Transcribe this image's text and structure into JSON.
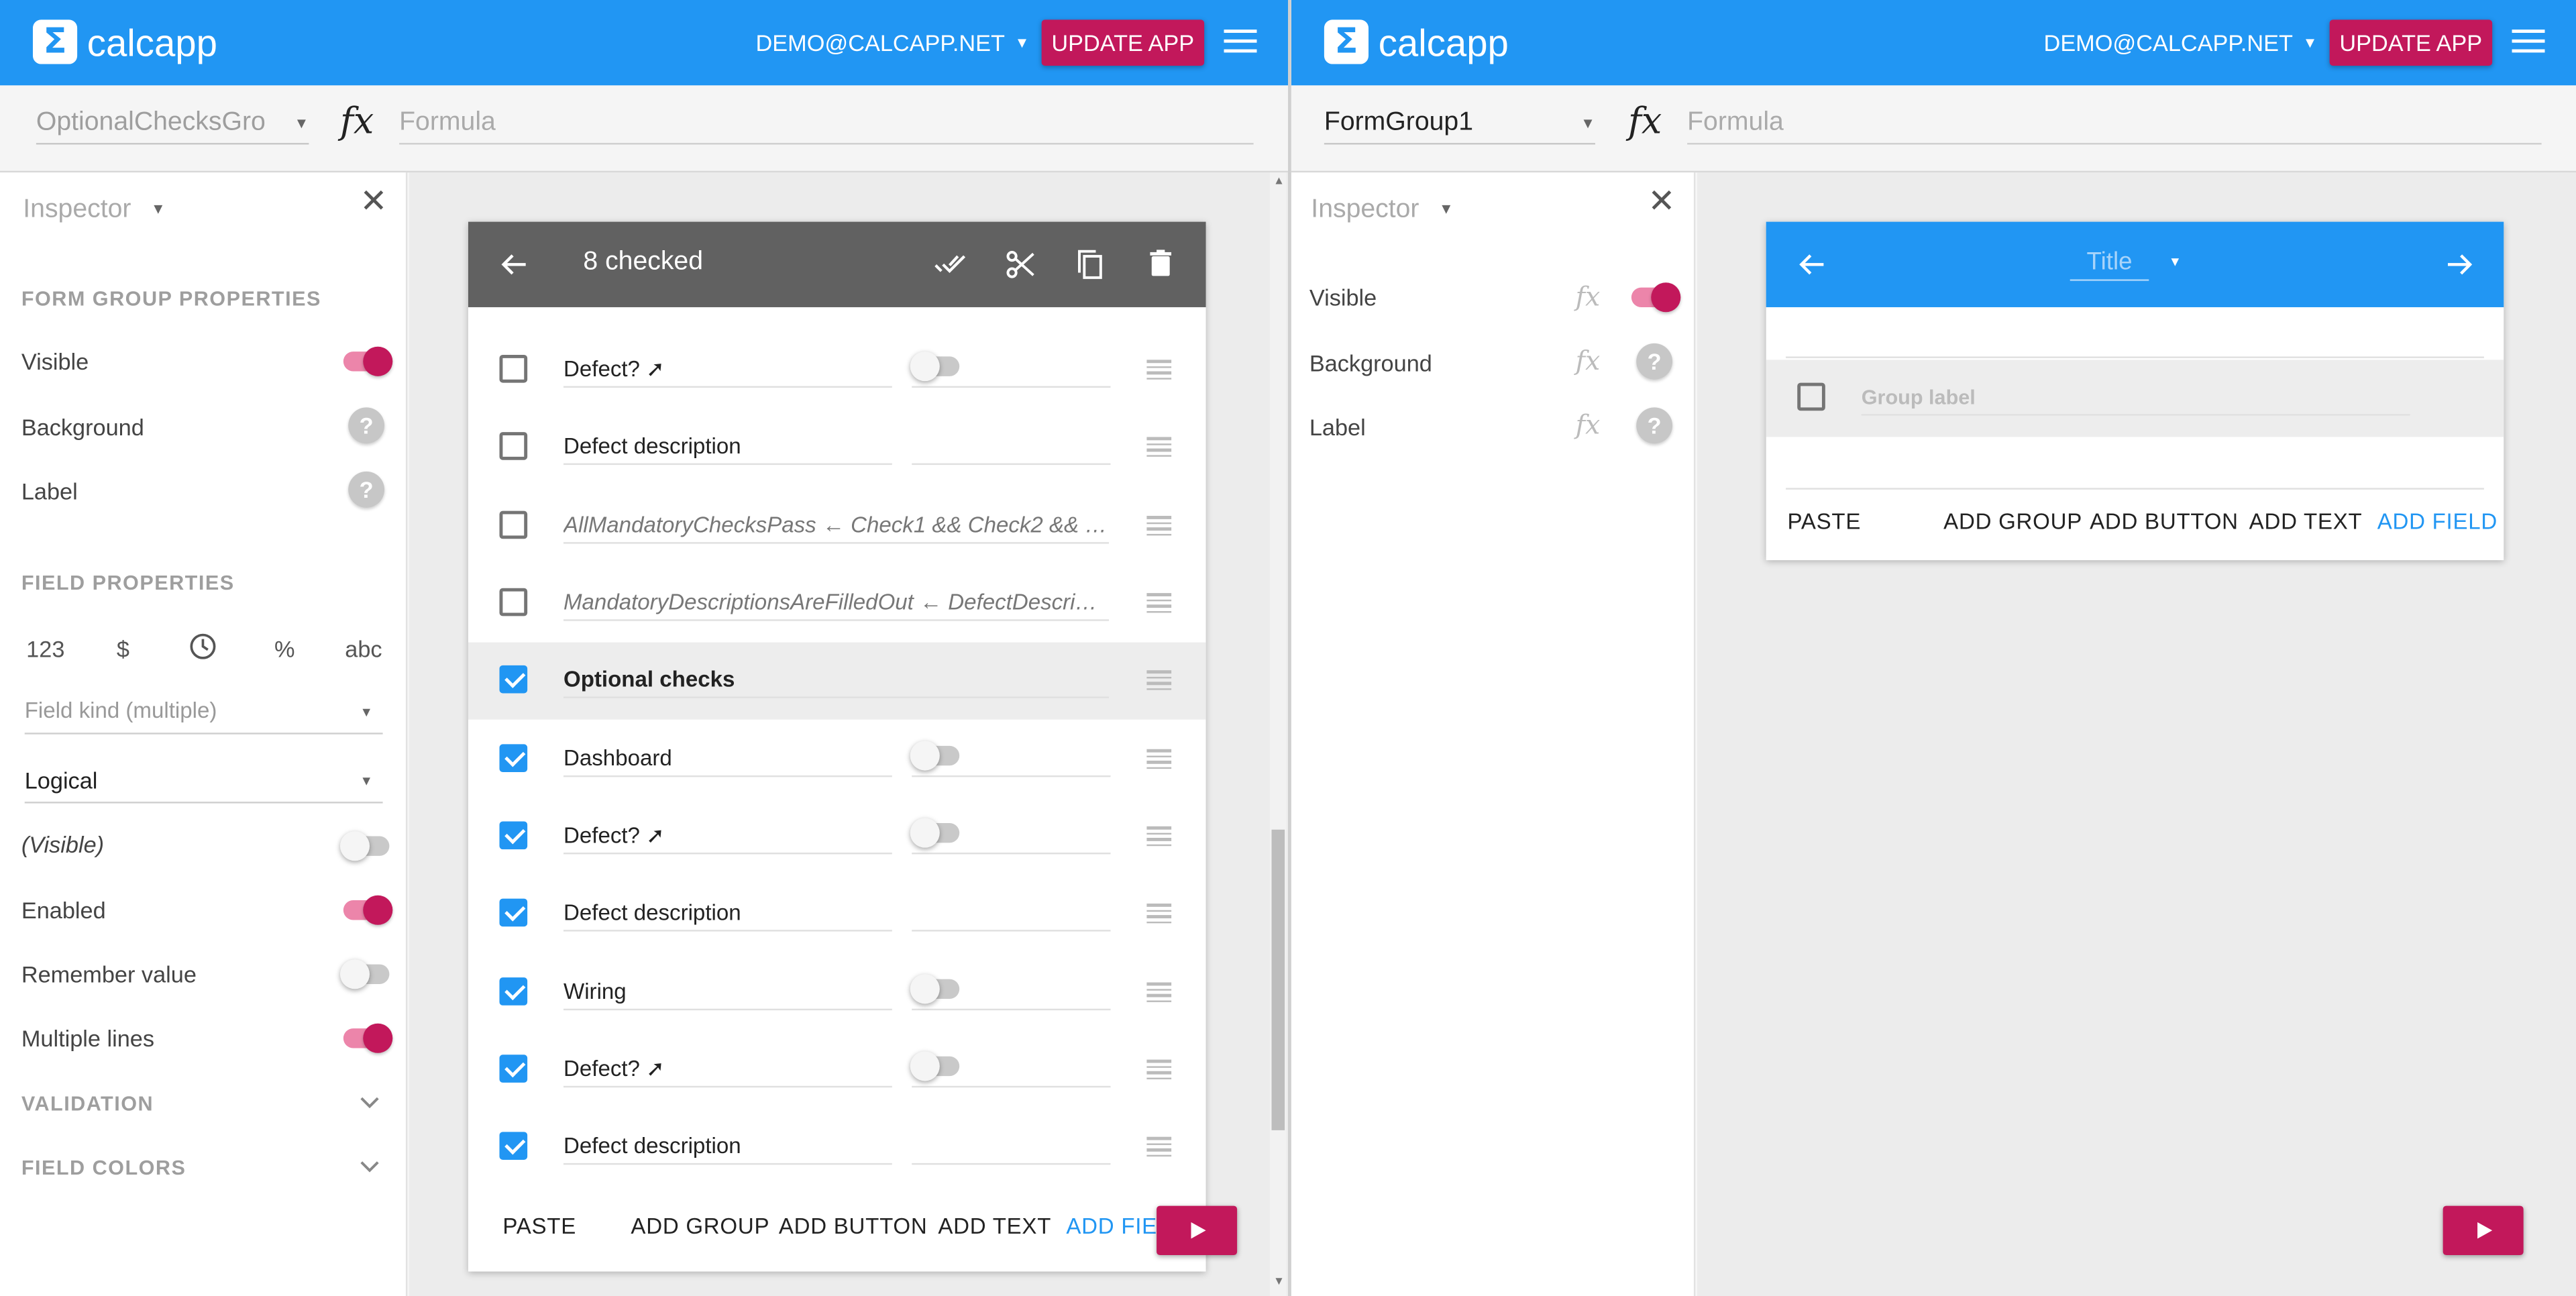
{
  "left": {
    "header": {
      "brand": "calcapp",
      "account": "DEMO@CALCAPP.NET",
      "update": "UPDATE APP"
    },
    "toolbar": {
      "selector": "OptionalChecksGro",
      "formula_placeholder": "Formula"
    },
    "inspector": {
      "title": "Inspector",
      "form_group_section": "FORM GROUP PROPERTIES",
      "visible": "Visible",
      "background": "Background",
      "label": "Label",
      "field_section": "FIELD PROPERTIES",
      "formats": [
        "123",
        "$",
        "%",
        "abc"
      ],
      "field_kind_placeholder": "Field kind (multiple)",
      "field_type": "Logical",
      "visible_formula": "(Visible)",
      "enabled": "Enabled",
      "remember": "Remember value",
      "multiline": "Multiple lines",
      "validation": "VALIDATION",
      "field_colors": "FIELD COLORS",
      "toggles": {
        "visible": true,
        "visible_formula": false,
        "enabled": true,
        "remember": false,
        "multiline": true
      }
    },
    "card": {
      "title": "8 checked",
      "rows": [
        {
          "label": "Defect? ➚",
          "checked": false,
          "value": "toggle"
        },
        {
          "label": "Defect description",
          "checked": false,
          "value": "text"
        },
        {
          "label": "AllMandatoryChecksPass ← Check1 && Check2 && Chec…",
          "checked": false,
          "value": "none",
          "style": "formula"
        },
        {
          "label": "MandatoryDescriptionsAreFilledOut ← DefectDescription…",
          "checked": false,
          "value": "none",
          "style": "formula"
        },
        {
          "label": "Optional checks",
          "checked": true,
          "value": "none",
          "style": "group"
        },
        {
          "label": "Dashboard",
          "checked": true,
          "value": "toggle"
        },
        {
          "label": "Defect? ➚",
          "checked": true,
          "value": "toggle"
        },
        {
          "label": "Defect description",
          "checked": true,
          "value": "text"
        },
        {
          "label": "Wiring",
          "checked": true,
          "value": "toggle"
        },
        {
          "label": "Defect? ➚",
          "checked": true,
          "value": "toggle"
        },
        {
          "label": "Defect description",
          "checked": true,
          "value": "text"
        }
      ],
      "actions": {
        "paste": "PASTE",
        "add_group": "ADD GROUP",
        "add_button": "ADD BUTTON",
        "add_text": "ADD TEXT",
        "add_field": "ADD FIEL"
      }
    }
  },
  "right": {
    "header": {
      "brand": "calcapp",
      "account": "DEMO@CALCAPP.NET",
      "update": "UPDATE APP"
    },
    "toolbar": {
      "selector": "FormGroup1",
      "formula_placeholder": "Formula"
    },
    "inspector": {
      "title": "Inspector",
      "visible": "Visible",
      "background": "Background",
      "label": "Label",
      "toggles": {
        "visible": true
      }
    },
    "card": {
      "title_placeholder": "Title",
      "group_label_placeholder": "Group label",
      "actions": {
        "paste": "PASTE",
        "add_group": "ADD GROUP",
        "add_button": "ADD BUTTON",
        "add_text": "ADD TEXT",
        "add_field": "ADD FIELD"
      }
    }
  },
  "colors": {
    "primary": "#2196f3",
    "accent": "#c2185b",
    "card_bar_selection": "#616161"
  }
}
